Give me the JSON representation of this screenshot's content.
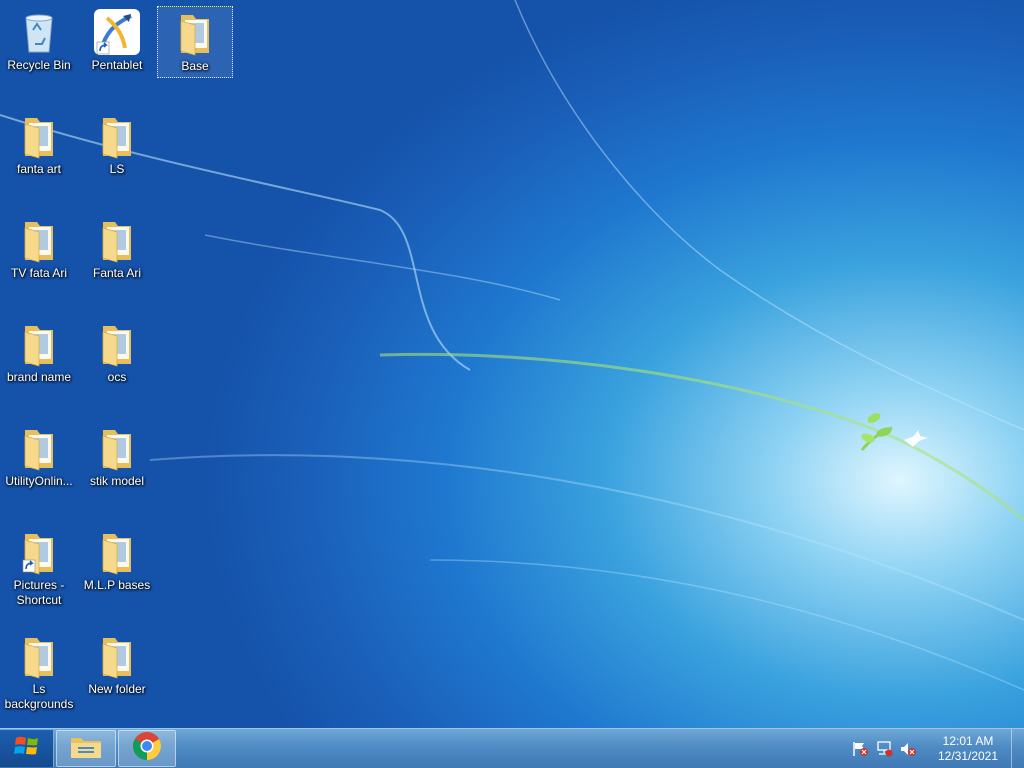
{
  "desktop": {
    "icons": [
      {
        "label": "Recycle Bin",
        "icon": "recycle-bin-icon"
      },
      {
        "label": "Pentablet",
        "icon": "pentablet-app-icon"
      },
      {
        "label": "Base",
        "icon": "folder-icon",
        "selected": true
      },
      {
        "label": "fanta art",
        "icon": "folder-icon"
      },
      {
        "label": "LS",
        "icon": "folder-icon"
      },
      {
        "label": "TV  fata Ari",
        "icon": "folder-icon"
      },
      {
        "label": "Fanta Ari",
        "icon": "folder-icon"
      },
      {
        "label": "brand name",
        "icon": "folder-icon"
      },
      {
        "label": "ocs",
        "icon": "folder-icon"
      },
      {
        "label": "UtilityOnlin...",
        "icon": "folder-icon"
      },
      {
        "label": "stik  model",
        "icon": "folder-icon"
      },
      {
        "label": "Pictures - Shortcut",
        "icon": "folder-shortcut-icon"
      },
      {
        "label": "M.L.P bases",
        "icon": "folder-icon"
      },
      {
        "label": "Ls backgrounds",
        "icon": "folder-icon"
      },
      {
        "label": "New folder",
        "icon": "folder-icon"
      }
    ]
  },
  "taskbar": {
    "start_icon": "windows-logo-icon",
    "pinned": [
      {
        "name": "File Explorer",
        "icon": "file-explorer-icon"
      },
      {
        "name": "Google Chrome",
        "icon": "chrome-icon"
      }
    ],
    "tray_icons": [
      "action-center-flag-icon",
      "network-icon",
      "volume-muted-icon"
    ],
    "clock": {
      "time": "12:01 AM",
      "date": "12/31/2021"
    }
  },
  "colors": {
    "folder": "#f3d27a",
    "taskbar": "#4f8bc4",
    "accent": "#1f78cf"
  }
}
